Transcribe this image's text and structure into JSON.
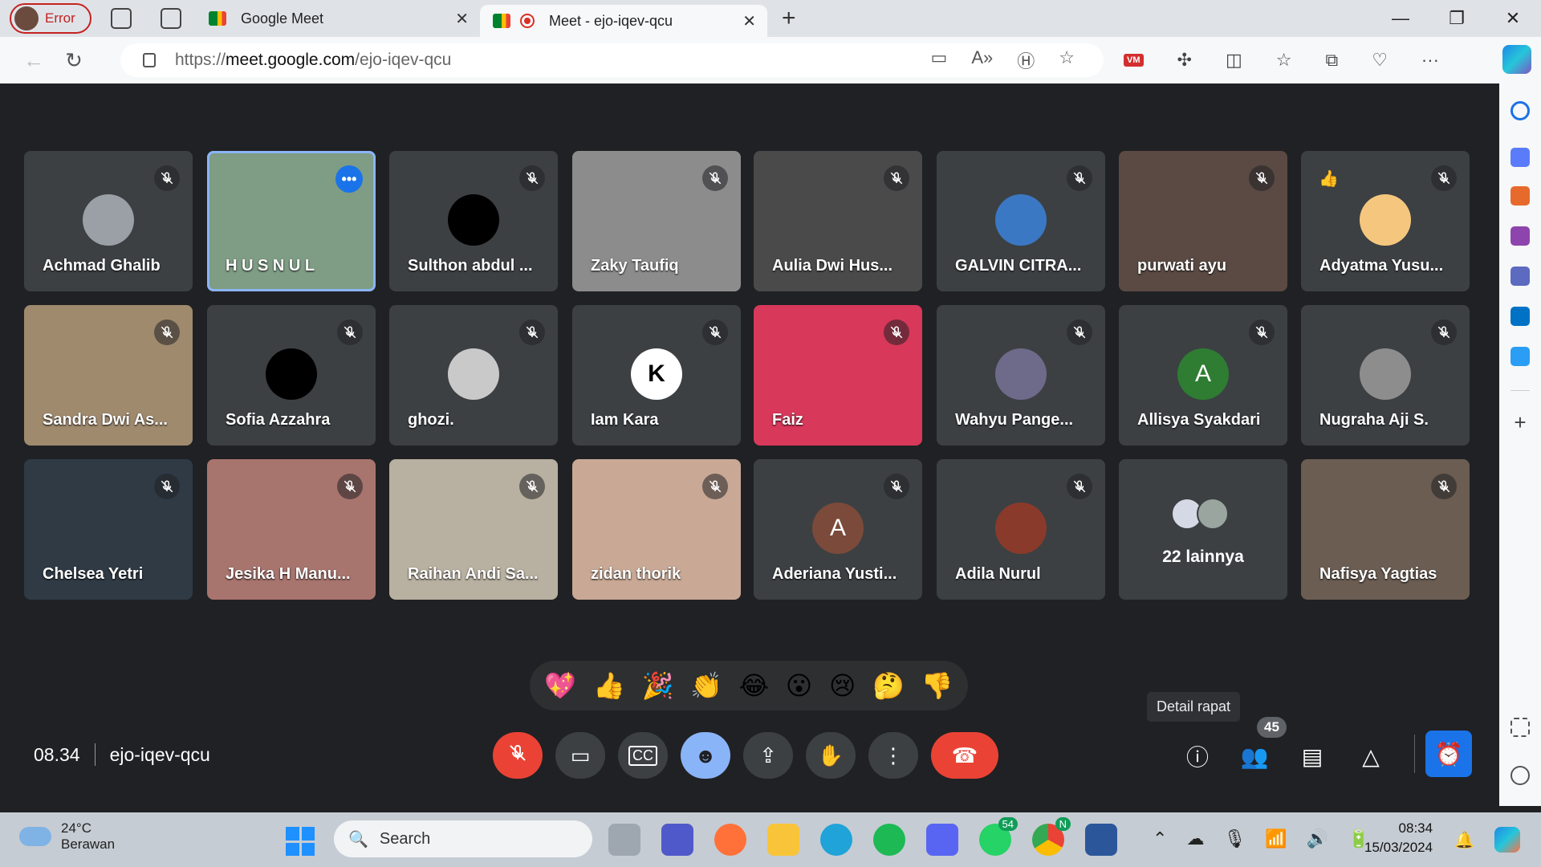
{
  "browser": {
    "profile_label": "Error",
    "tabs": [
      {
        "title": "Google Meet"
      },
      {
        "title": "Meet - ejo-iqev-qcu"
      }
    ],
    "url_scheme": "https://",
    "url_host": "meet.google.com",
    "url_path": "/ejo-iqev-qcu"
  },
  "meeting": {
    "time": "08.34",
    "code": "ejo-iqev-qcu",
    "participant_count": "45",
    "tooltip": "Detail rapat",
    "overflow_label": "22 lainnya"
  },
  "participants": [
    {
      "name": "Achmad Ghalib"
    },
    {
      "name": "H U S N U L"
    },
    {
      "name": "Sulthon abdul ..."
    },
    {
      "name": "Zaky Taufiq"
    },
    {
      "name": "Aulia Dwi Hus..."
    },
    {
      "name": "GALVIN CITRA..."
    },
    {
      "name": "purwati ayu"
    },
    {
      "name": "Adyatma Yusu..."
    },
    {
      "name": "Sandra Dwi As..."
    },
    {
      "name": "Sofia Azzahra"
    },
    {
      "name": "ghozi."
    },
    {
      "name": "Iam Kara"
    },
    {
      "name": "Faiz"
    },
    {
      "name": "Wahyu Pange..."
    },
    {
      "name": "Allisya Syakdari",
      "initial": "A"
    },
    {
      "name": "Nugraha Aji S."
    },
    {
      "name": "Chelsea Yetri"
    },
    {
      "name": "Jesika H Manu..."
    },
    {
      "name": "Raihan Andi Sa..."
    },
    {
      "name": "zidan thorik"
    },
    {
      "name": "Aderiana Yusti...",
      "initial": "A"
    },
    {
      "name": "Adila Nurul"
    },
    {
      "name": "Nafisya Yagtias"
    }
  ],
  "reactions": [
    "💖",
    "👍",
    "🎉",
    "👏",
    "😂",
    "😮",
    "😢",
    "🤔",
    "👎"
  ],
  "taskbar": {
    "temperature": "24°C",
    "weather": "Berawan",
    "search_placeholder": "Search",
    "clock_time": "08:34",
    "clock_date": "15/03/2024",
    "whatsapp_badge": "54",
    "chrome_badge": "N"
  },
  "colors": {
    "meet_bg": "#202124",
    "tile_bg": "#3c4043",
    "danger": "#ea4335",
    "accent": "#8ab4f8",
    "primary": "#1a73e8"
  }
}
